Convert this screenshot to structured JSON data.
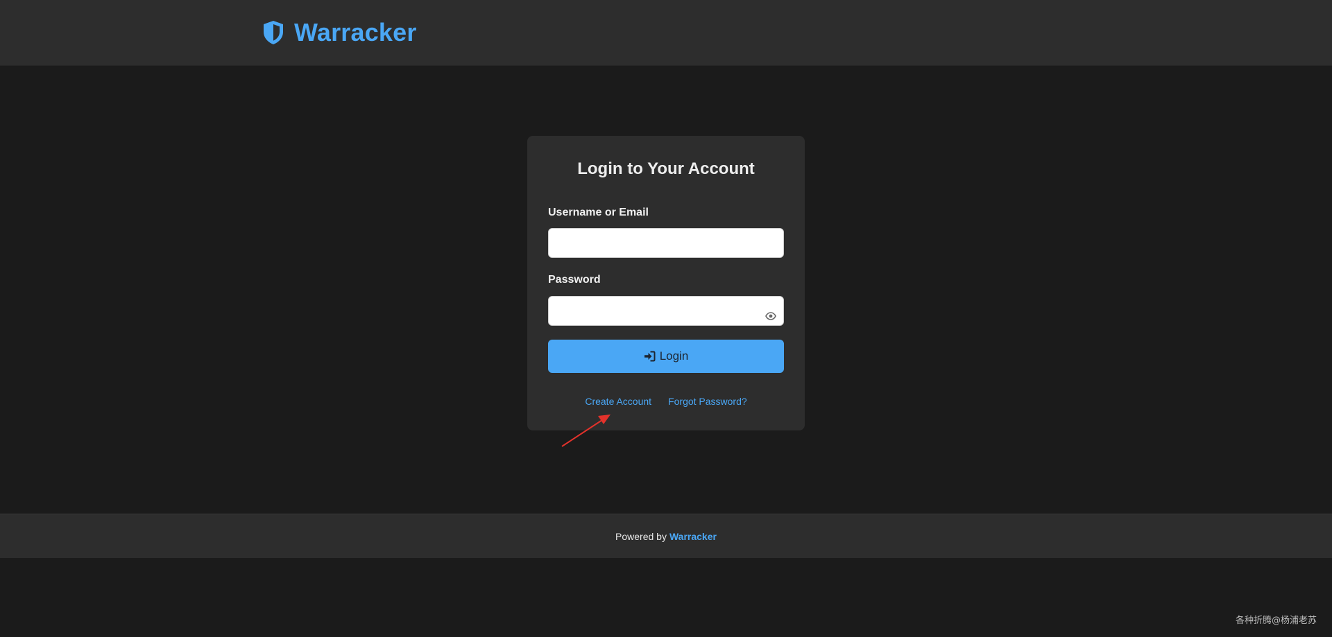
{
  "header": {
    "brand_name": "Warracker",
    "brand_icon": "shield-icon",
    "brand_color": "#4aa7f5"
  },
  "login_card": {
    "title": "Login to Your Account",
    "username_label": "Username or Email",
    "username_value": "",
    "username_placeholder": "",
    "password_label": "Password",
    "password_value": "",
    "password_placeholder": "",
    "password_toggle_icon": "eye-icon",
    "login_button_icon": "sign-in-icon",
    "login_button_label": "Login",
    "create_account_link": "Create Account",
    "forgot_password_link": "Forgot Password?"
  },
  "annotation": {
    "arrow_color": "#e3322b"
  },
  "footer": {
    "powered_by_text": "Powered by",
    "powered_by_link": "Warracker"
  },
  "watermark": {
    "text": "各种折腾@杨浦老苏"
  },
  "colors": {
    "background": "#1b1b1b",
    "panel": "#2d2d2d",
    "accent": "#4aa7f5"
  }
}
